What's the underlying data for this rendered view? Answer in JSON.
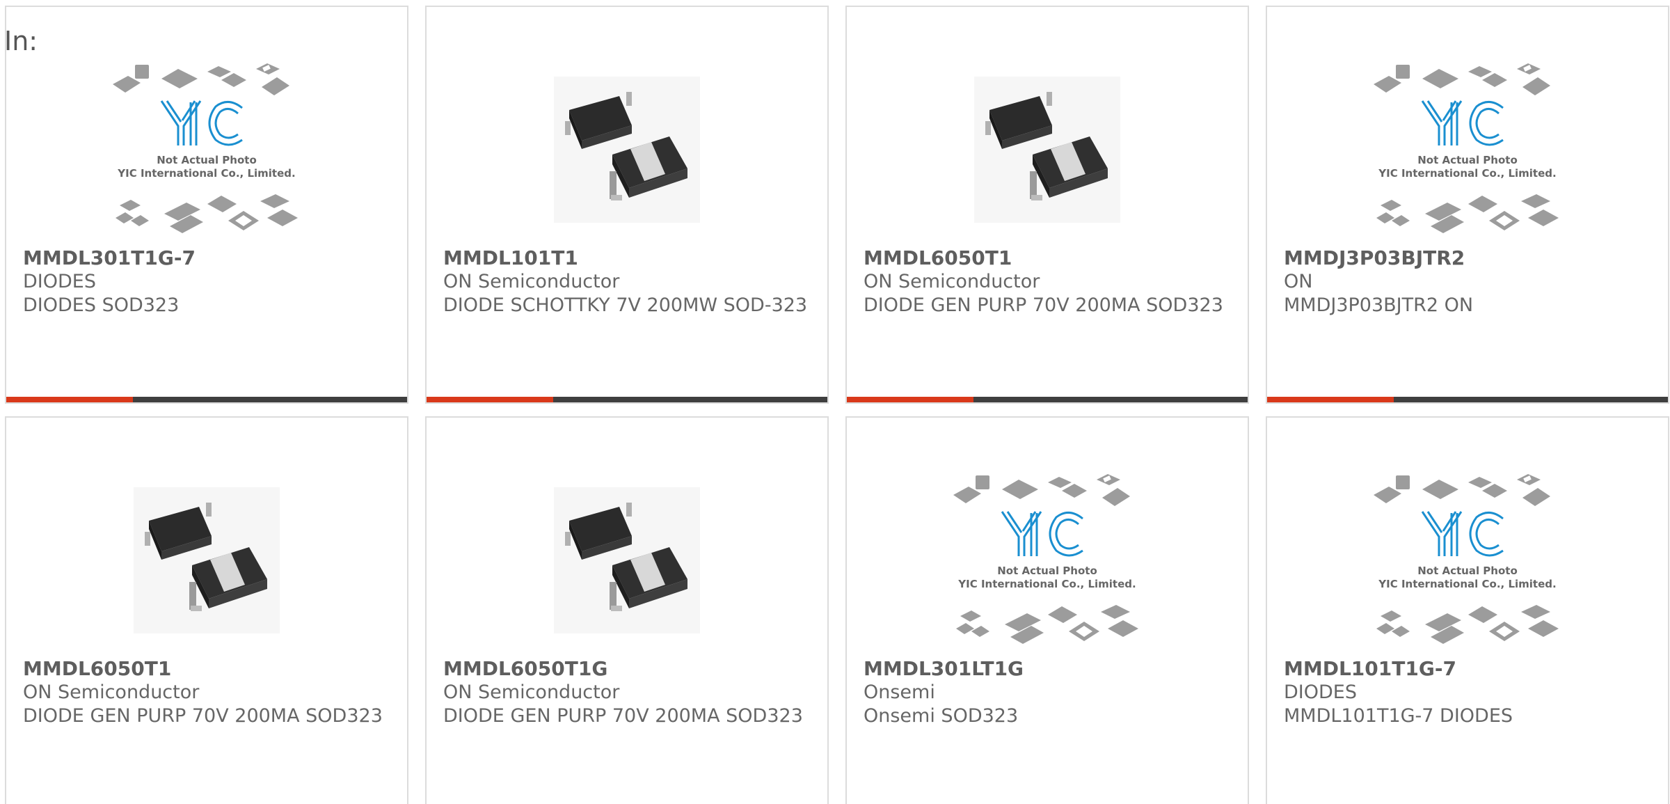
{
  "page": {
    "in_label": "In:"
  },
  "colors": {
    "accent_bar": "#d9391a",
    "dark_bar": "#3f3f3f",
    "card_border": "#dcdcdc",
    "text": "#666666",
    "logo_blue": "#1a8fd0"
  },
  "placeholder": {
    "line1": "Not Actual Photo",
    "line2": "YIC International Co., Limited.",
    "logo_text": "YIC"
  },
  "products": [
    {
      "part": "MMDL301T1G-7",
      "brand": "DIODES",
      "desc": "DIODES SOD323",
      "image": "placeholder-icon"
    },
    {
      "part": "MMDL101T1",
      "brand": "ON Semiconductor",
      "desc": "DIODE SCHOTTKY 7V 200MW SOD-323",
      "image": "sod323-package-icon"
    },
    {
      "part": "MMDL6050T1",
      "brand": "ON Semiconductor",
      "desc": "DIODE GEN PURP 70V 200MA SOD323",
      "image": "sod323-package-icon"
    },
    {
      "part": "MMDJ3P03BJTR2",
      "brand": "ON",
      "desc": "MMDJ3P03BJTR2 ON",
      "image": "placeholder-icon"
    },
    {
      "part": "MMDL6050T1",
      "brand": "ON Semiconductor",
      "desc": "DIODE GEN PURP 70V 200MA SOD323",
      "image": "sod323-package-icon"
    },
    {
      "part": "MMDL6050T1G",
      "brand": "ON Semiconductor",
      "desc": "DIODE GEN PURP 70V 200MA SOD323",
      "image": "sod323-package-icon"
    },
    {
      "part": "MMDL301LT1G",
      "brand": "Onsemi",
      "desc": "Onsemi SOD323",
      "image": "placeholder-icon"
    },
    {
      "part": "MMDL101T1G-7",
      "brand": "DIODES",
      "desc": "MMDL101T1G-7 DIODES",
      "image": "placeholder-icon"
    }
  ]
}
